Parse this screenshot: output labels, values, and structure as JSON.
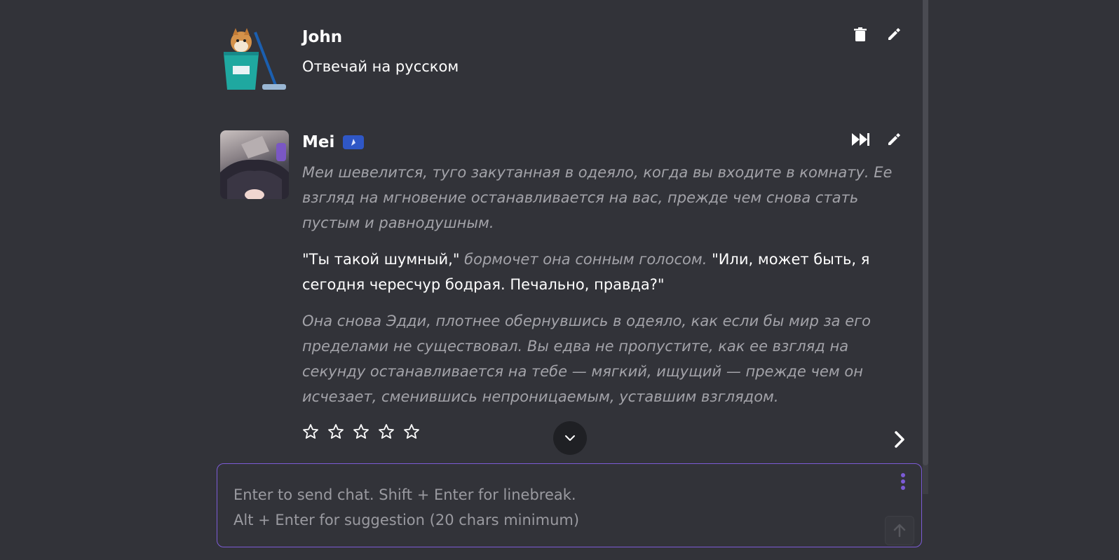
{
  "colors": {
    "background": "#323339",
    "accent_border": "#7c5bd6",
    "bot_badge": "#2f57c6",
    "italic_text": "#a3a3a9",
    "placeholder": "#9a9aa0"
  },
  "messages": [
    {
      "author": "John",
      "avatar": "doge-janitor-avatar",
      "actions": [
        "trash-icon",
        "pencil-icon"
      ],
      "text": "Отвечай на русском"
    },
    {
      "author": "Mei",
      "avatar": "anime-girl-avatar",
      "bot_badge_icon": "bot-badge-icon",
      "actions": [
        "fast-forward-icon",
        "pencil-icon"
      ],
      "paragraph1": "Меи шевелится, туго закутанная в одеяло, когда вы входите в комнату. Ее взгляд на мгновение останавливается на вас, прежде чем снова стать пустым и равнодушным.",
      "paragraph2_speech1": "\"Ты такой шумный,\"",
      "paragraph2_narration": "бормочет она сонным голосом.",
      "paragraph2_speech2": "\"Или, может быть, я сегодня чересчур бодрая. Печально, правда?\"",
      "paragraph3": "Она снова Эдди, плотнее обернувшись в одеяло, как если бы мир за его пределами не существовал. Вы едва не пропустите, как ее взгляд на секунду останавливается на тебе — мягкий, ищущий — прежде чем он исчезает, сменившись непроницаемым, уставшим взглядом.",
      "rating_stars": 5,
      "rating_value": 0
    }
  ],
  "composer": {
    "placeholder": "Enter to send chat. Shift + Enter for linebreak.\nAlt + Enter for suggestion (20 chars minimum)",
    "value": ""
  }
}
